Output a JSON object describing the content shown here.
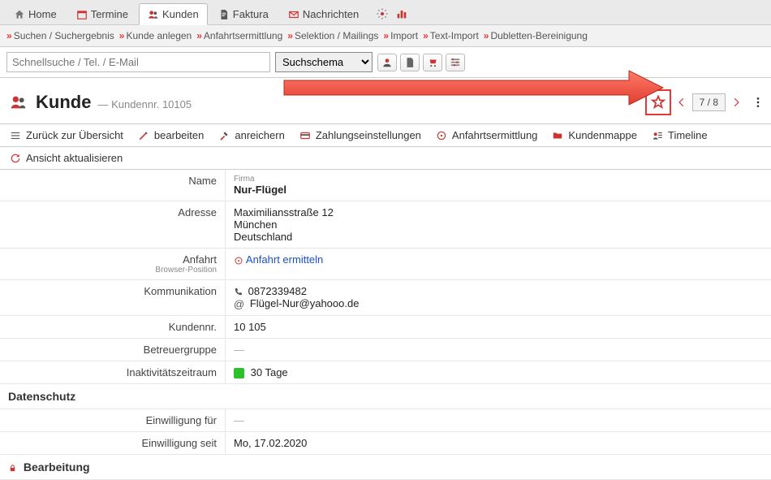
{
  "top_tabs": {
    "home": "Home",
    "termine": "Termine",
    "kunden": "Kunden",
    "faktura": "Faktura",
    "nachrichten": "Nachrichten"
  },
  "sub_nav": {
    "suchen": "Suchen / Suchergebnis",
    "kunde_anlegen": "Kunde anlegen",
    "anfahrt": "Anfahrtsermittlung",
    "selektion": "Selektion / Mailings",
    "import": "Import",
    "text_import": "Text-Import",
    "dubletten": "Dubletten-Bereinigung"
  },
  "search": {
    "placeholder": "Schnellsuche / Tel. / E-Mail",
    "schema_label": "Suchschema"
  },
  "header": {
    "title": "Kunde",
    "subtitle": "— Kundennr. 10105",
    "pager": "7 / 8"
  },
  "toolbar": {
    "back": "Zurück zur Übersicht",
    "edit": "bearbeiten",
    "enrich": "anreichern",
    "payment": "Zahlungseinstellungen",
    "route": "Anfahrtsermittlung",
    "folder": "Kundenmappe",
    "timeline": "Timeline",
    "refresh": "Ansicht aktualisieren"
  },
  "labels": {
    "name": "Name",
    "adresse": "Adresse",
    "anfahrt": "Anfahrt",
    "anfahrt_sub": "Browser-Position",
    "kommunikation": "Kommunikation",
    "kundennr": "Kundennr.",
    "betreuergruppe": "Betreuergruppe",
    "inaktiv": "Inaktivitätszeitraum",
    "datenschutz": "Datenschutz",
    "einwilligung_fuer": "Einwilligung für",
    "einwilligung_seit": "Einwilligung seit",
    "bearbeitung": "Bearbeitung"
  },
  "values": {
    "firma_label": "Firma",
    "firma_name": "Nur-Flügel",
    "street": "Maximiliansstraße 12",
    "city": "München",
    "country": "Deutschland",
    "anfahrt_link": "Anfahrt ermitteln",
    "phone": "0872339482",
    "email": "Flügel-Nur@yahooo.de",
    "kundennr": "10 105",
    "betreuergruppe": "—",
    "inaktiv": "30 Tage",
    "einwilligung_fuer": "—",
    "einwilligung_seit": "Mo, 17.02.2020"
  }
}
